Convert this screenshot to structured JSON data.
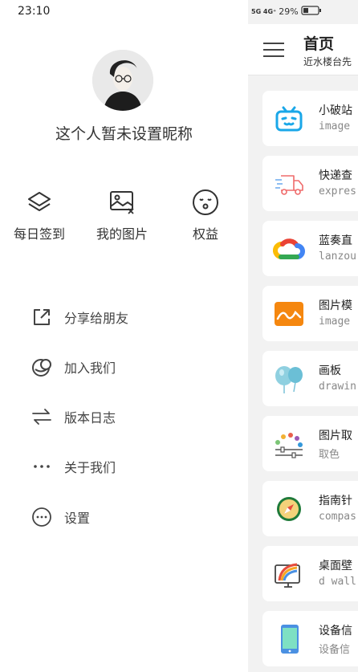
{
  "status": {
    "time": "23:10",
    "network": "5G 4G⁺",
    "battery": "29%"
  },
  "drawer": {
    "nickname": "这个人暂未设置昵称",
    "quick_actions": [
      {
        "icon": "layers-icon",
        "label": "每日签到"
      },
      {
        "icon": "image-icon",
        "label": "我的图片"
      },
      {
        "icon": "face-icon",
        "label": "权益"
      }
    ],
    "menu": [
      {
        "icon": "share-icon",
        "label": "分享给朋友"
      },
      {
        "icon": "join-icon",
        "label": "加入我们"
      },
      {
        "icon": "swap-icon",
        "label": "版本日志"
      },
      {
        "icon": "more-icon",
        "label": "关于我们"
      },
      {
        "icon": "settings-icon",
        "label": "设置"
      }
    ]
  },
  "main": {
    "title": "首页",
    "subtitle": "近水楼台先",
    "cards": [
      {
        "icon": "tv-icon",
        "title": "小破站",
        "sub": "image"
      },
      {
        "icon": "truck-icon",
        "title": "快递查",
        "sub": "expres"
      },
      {
        "icon": "cloud-icon",
        "title": "蓝奏直",
        "sub": "lanzou"
      },
      {
        "icon": "landscape-icon",
        "title": "图片模",
        "sub": "image"
      },
      {
        "icon": "balloon-icon",
        "title": "画板",
        "sub": "drawin"
      },
      {
        "icon": "palette-icon",
        "title": "图片取",
        "sub": "取色"
      },
      {
        "icon": "compass-icon",
        "title": "指南针",
        "sub": "compas"
      },
      {
        "icon": "monitor-icon",
        "title": "桌面壁",
        "sub": "d wall"
      },
      {
        "icon": "phone-icon",
        "title": "设备信",
        "sub": "设备信"
      }
    ]
  }
}
